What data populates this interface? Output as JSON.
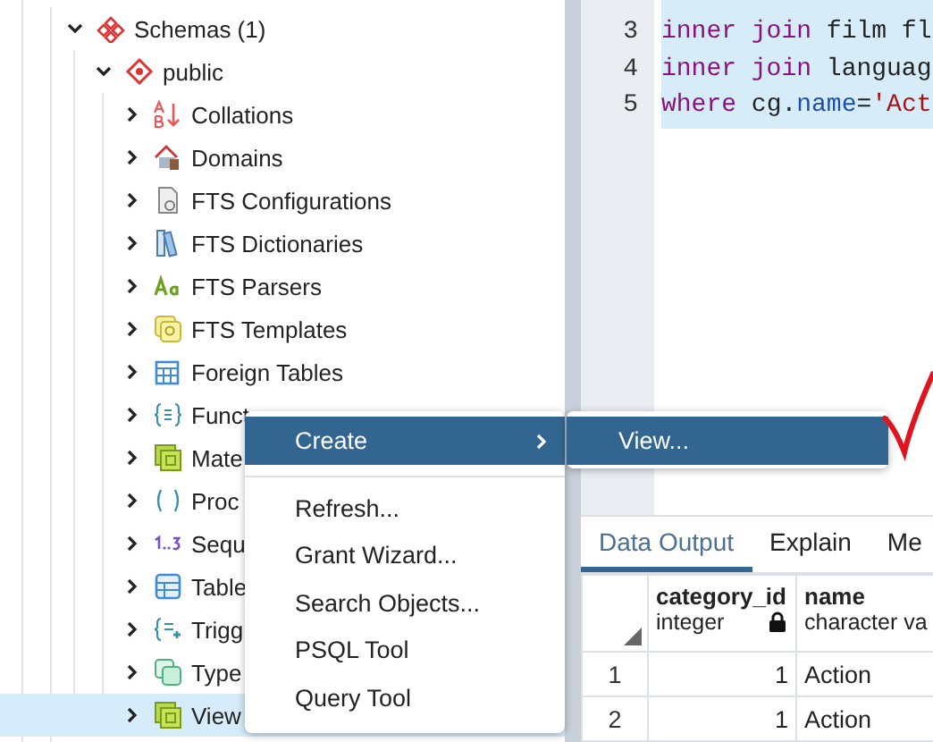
{
  "tree": {
    "items": [
      {
        "label": "Schemas (1)",
        "expanded": true,
        "selected": false,
        "children": [
          {
            "label": "public",
            "expanded": true,
            "selected": false,
            "children": [
              {
                "label": "Collations",
                "expanded": false,
                "selected": false
              },
              {
                "label": "Domains",
                "expanded": false,
                "selected": false
              },
              {
                "label": "FTS Configurations",
                "expanded": false,
                "selected": false
              },
              {
                "label": "FTS Dictionaries",
                "expanded": false,
                "selected": false
              },
              {
                "label": "FTS Parsers",
                "expanded": false,
                "selected": false
              },
              {
                "label": "FTS Templates",
                "expanded": false,
                "selected": false
              },
              {
                "label": "Foreign Tables",
                "expanded": false,
                "selected": false
              },
              {
                "label": "Funct",
                "expanded": false,
                "selected": false
              },
              {
                "label": "Mate",
                "expanded": false,
                "selected": false
              },
              {
                "label": "Proc",
                "expanded": false,
                "selected": false
              },
              {
                "label": "Sequ",
                "expanded": false,
                "selected": false
              },
              {
                "label": "Table",
                "expanded": false,
                "selected": false
              },
              {
                "label": "Trigg",
                "expanded": false,
                "selected": false
              },
              {
                "label": "Type",
                "expanded": false,
                "selected": false
              },
              {
                "label": "View",
                "expanded": false,
                "selected": true
              }
            ]
          }
        ]
      }
    ]
  },
  "editor": {
    "lines": [
      {
        "number": "3",
        "highlighted": true,
        "tokens": [
          {
            "kind": "keyword",
            "text": "inner join"
          },
          {
            "kind": "plain",
            "text": " film fl"
          }
        ]
      },
      {
        "number": "4",
        "highlighted": true,
        "tokens": [
          {
            "kind": "keyword",
            "text": "inner join"
          },
          {
            "kind": "plain",
            "text": " languag"
          }
        ]
      },
      {
        "number": "5",
        "highlighted": true,
        "tokens": [
          {
            "kind": "keyword",
            "text": "where"
          },
          {
            "kind": "plain",
            "text": " cg."
          },
          {
            "kind": "property",
            "text": "name"
          },
          {
            "kind": "plain",
            "text": "="
          },
          {
            "kind": "string",
            "text": "'Act"
          }
        ]
      }
    ]
  },
  "context_menu": {
    "items": [
      {
        "kind": "submenu",
        "label": "Create",
        "selected": true
      },
      {
        "kind": "separator"
      },
      {
        "kind": "item",
        "label": "Refresh...",
        "selected": false
      },
      {
        "kind": "item",
        "label": "Grant Wizard...",
        "selected": false
      },
      {
        "kind": "item",
        "label": "Search Objects...",
        "selected": false
      },
      {
        "kind": "item",
        "label": "PSQL Tool",
        "selected": false
      },
      {
        "kind": "item",
        "label": "Query Tool",
        "selected": false
      }
    ],
    "submenu": {
      "items": [
        {
          "label": "View...",
          "selected": true
        }
      ]
    }
  },
  "results": {
    "tabs": [
      {
        "label": "Data Output",
        "selected": true
      },
      {
        "label": "Explain",
        "selected": false
      },
      {
        "label": "Me",
        "selected": false
      }
    ],
    "columns": [
      {
        "name": "category_id",
        "type": "integer",
        "primary_key": true
      },
      {
        "name": "name",
        "type": "character va",
        "primary_key": false
      }
    ],
    "rows": [
      {
        "number": "1",
        "cells": [
          "1",
          "Action"
        ]
      },
      {
        "number": "2",
        "cells": [
          "1",
          "Action"
        ]
      }
    ]
  }
}
